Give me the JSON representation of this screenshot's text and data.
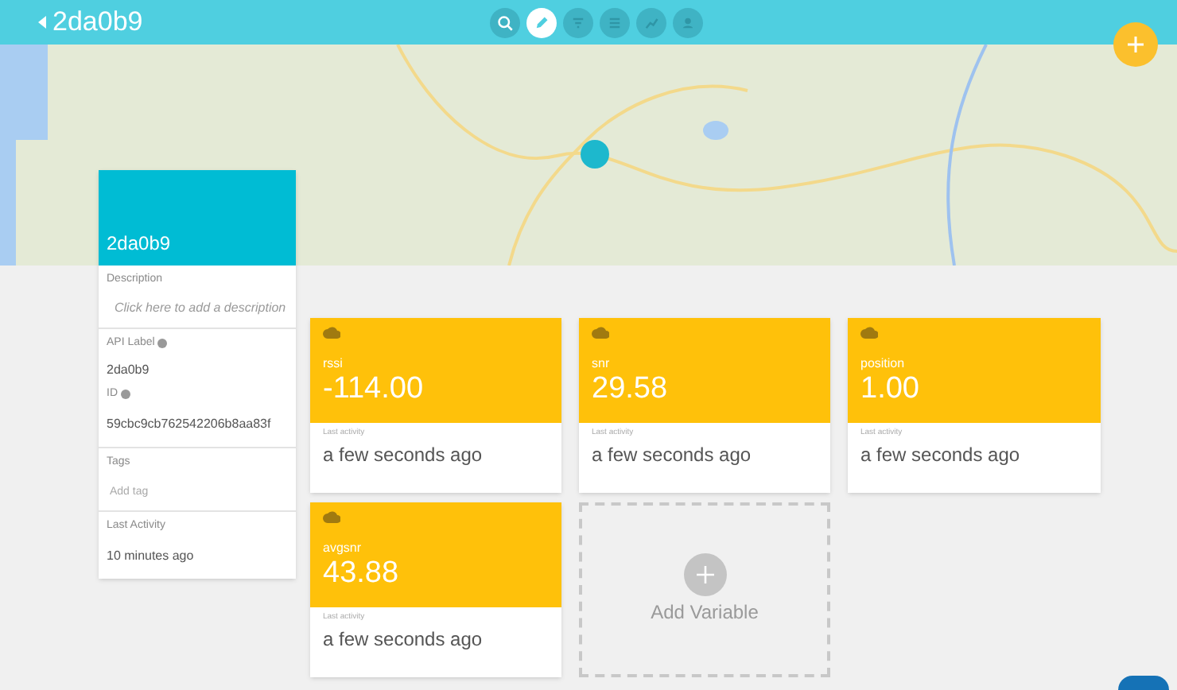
{
  "header": {
    "back_label": "2da0b9"
  },
  "toolbar": [
    {
      "kind": "search",
      "selected": false
    },
    {
      "kind": "edit",
      "selected": true
    },
    {
      "kind": "filter",
      "selected": false
    },
    {
      "kind": "list",
      "selected": false
    },
    {
      "kind": "chart",
      "selected": false
    },
    {
      "kind": "user",
      "selected": false
    }
  ],
  "device": {
    "name": "2da0b9",
    "description_label": "Description",
    "description_placeholder": "Click here to add a description",
    "api_label": "API Label",
    "api_value": "2da0b9",
    "id_label": "ID",
    "id_value": "59cbc9cb762542206b8aa83f",
    "tags_label": "Tags",
    "tags_placeholder": "Add tag",
    "last_activity_label": "Last Activity",
    "last_activity_value": "10 minutes ago"
  },
  "variables": [
    {
      "name": "rssi",
      "value": "-114.00",
      "activity_label": "Last activity",
      "activity": "a few seconds ago"
    },
    {
      "name": "snr",
      "value": "29.58",
      "activity_label": "Last activity",
      "activity": "a few seconds ago"
    },
    {
      "name": "position",
      "value": "1.00",
      "activity_label": "Last activity",
      "activity": "a few seconds ago"
    },
    {
      "name": "avgsnr",
      "value": "43.88",
      "activity_label": "Last activity",
      "activity": "a few seconds ago"
    }
  ],
  "add_variable": {
    "label": "Add Variable"
  }
}
